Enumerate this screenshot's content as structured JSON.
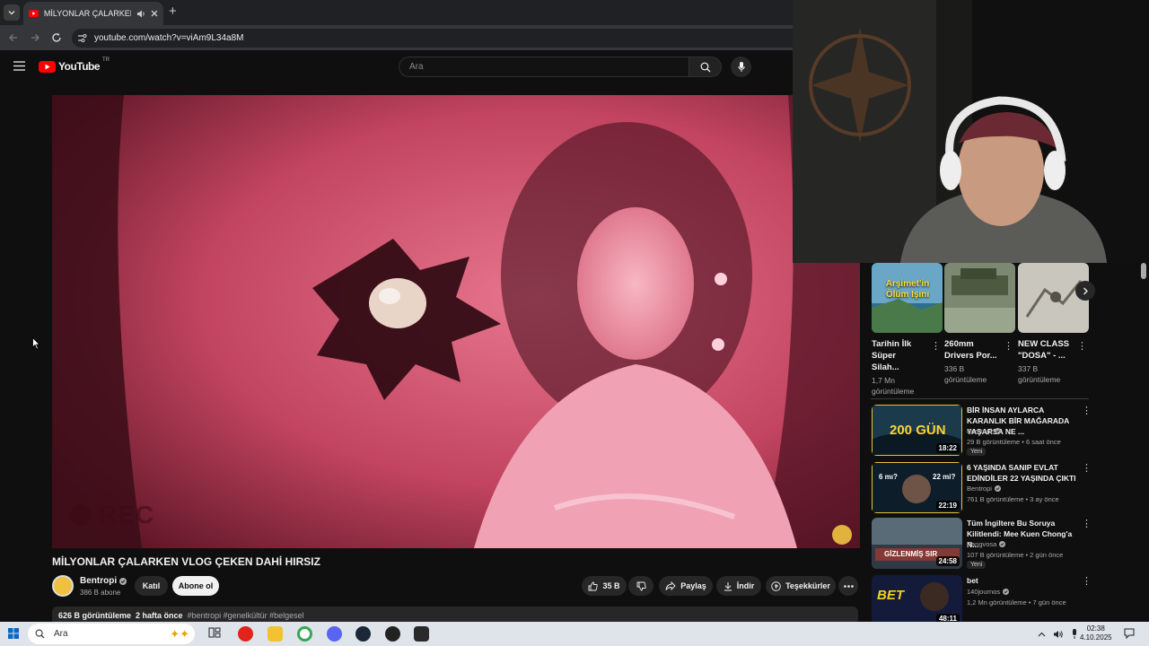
{
  "browser": {
    "tab_title": "MİLYONLAR ÇALARKEN VLOG ÇEKEN DAHİ HIRSIZ",
    "url": "youtube.com/watch?v=viAm9L34a8M",
    "new_tab": "+"
  },
  "header": {
    "logo_text": "YouTube",
    "region": "TR",
    "search_placeholder": "Ara"
  },
  "player": {
    "overlay_text": "REC"
  },
  "video": {
    "title": "MİLYONLAR ÇALARKEN VLOG ÇEKEN DAHİ HIRSIZ",
    "channel": "Bentropi",
    "subscribers": "386 B abone",
    "join_label": "Katıl",
    "subscribe_label": "Abone ol",
    "likes": "35 B",
    "share_label": "Paylaş",
    "download_label": "İndir",
    "thanks_label": "Teşekkürler",
    "views": "626 B görüntüleme",
    "age": "2 hafta önce",
    "hashtags": "#bentropi #genelkültür #belgesel"
  },
  "shelf": [
    {
      "title": "Tarihin İlk Süper Silah...",
      "views": "1,7 Mn",
      "unit": "görüntüleme",
      "thumb_text": "Arşimet'in Ölüm Işını"
    },
    {
      "title": "260mm Drivers Por...",
      "views": "336 B",
      "unit": "görüntüleme"
    },
    {
      "title": "NEW CLASS \"DOSA\" - ...",
      "views": "337 B",
      "unit": "görüntüleme"
    }
  ],
  "recommendations": [
    {
      "title": "BİR İNSAN AYLARCA KARANLIK BİR MAĞARADA YAŞARSA NE ...",
      "channel": "Bentropi",
      "meta": "29 B görüntüleme • 6 saat önce",
      "badge": "Yeni",
      "duration": "18:22",
      "thumb_text": "200 GÜN"
    },
    {
      "title": "6 YAŞINDA SANIP EVLAT EDİNDİLER 22 YAŞINDA ÇIKTI",
      "channel": "Bentropi",
      "meta": "761 B görüntüleme • 3 ay önce",
      "badge": "",
      "duration": "22:19",
      "thumb_text_left": "6 mı?",
      "thumb_text_right": "22 mi?"
    },
    {
      "title": "Tüm İngiltere Bu Soruya Kilitlendi: Mee Kuen Chong'a N...",
      "channel": "Pangvosa",
      "meta": "107 B görüntüleme • 2 gün önce",
      "badge": "Yeni",
      "duration": "24:58",
      "thumb_text": "GİZLENMİŞ SIR"
    },
    {
      "title": "bet",
      "channel": "140journos",
      "meta": "1,2 Mn görüntüleme • 7 gün önce",
      "badge": "",
      "duration": "48:11",
      "thumb_text": "BET"
    }
  ],
  "taskbar": {
    "search_placeholder": "Ara",
    "time": "02:38",
    "date": "4.10.2025"
  },
  "colors": {
    "yt_red": "#ff0000",
    "bg": "#0f0f0f",
    "video_tint": "#c84a63"
  }
}
